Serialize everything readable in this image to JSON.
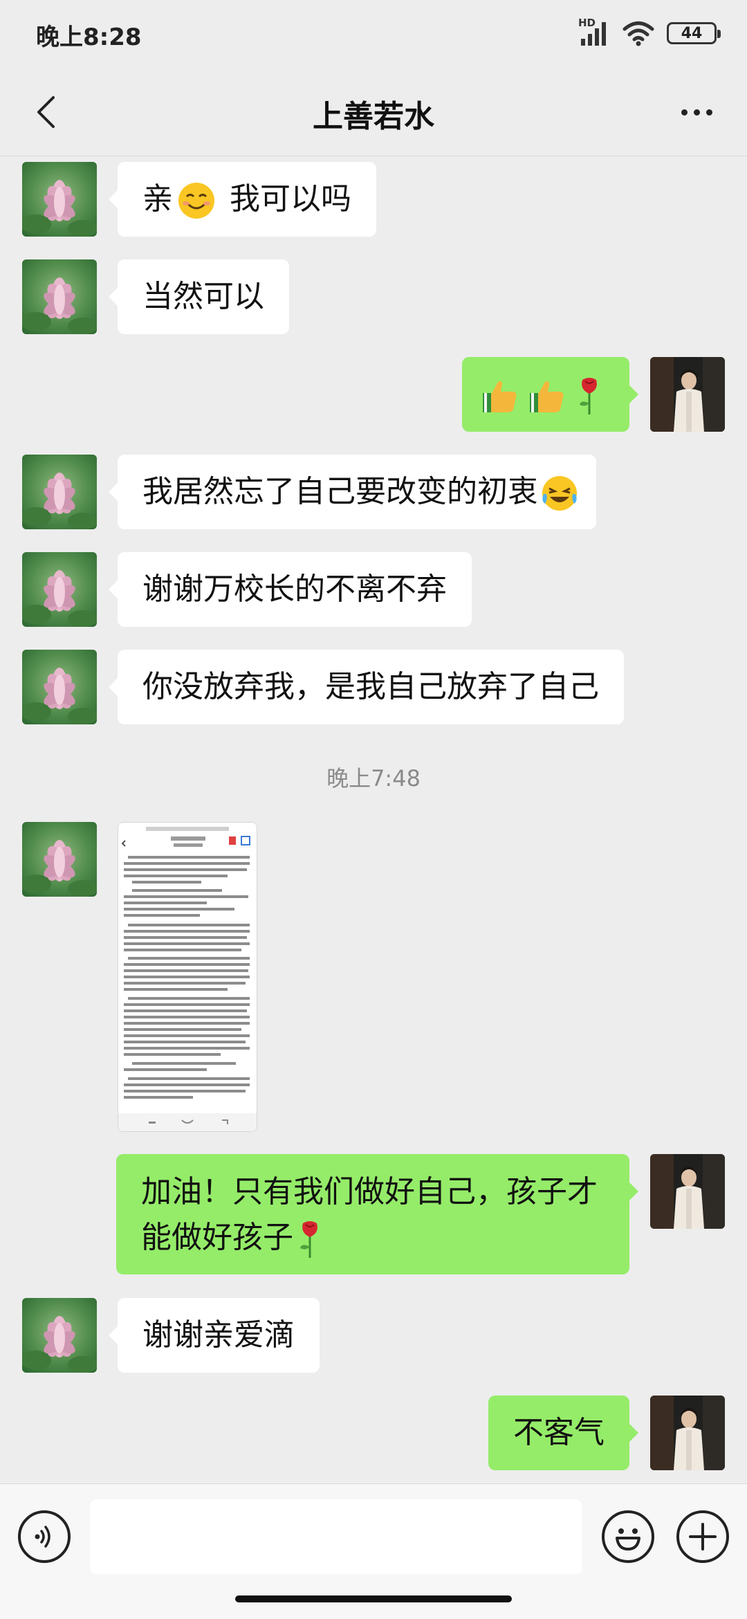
{
  "status_bar": {
    "time": "晚上8:28",
    "network": "HD",
    "battery": "44"
  },
  "header": {
    "title": "上善若水"
  },
  "messages": [
    {
      "side": "in",
      "text": "亲",
      "text_after": " 我可以吗",
      "emoji": "smiling-face"
    },
    {
      "side": "in",
      "text": "当然可以"
    },
    {
      "side": "out",
      "emoji": [
        "thumbs-up",
        "thumbs-up",
        "rose"
      ]
    },
    {
      "side": "in",
      "text": "我居然忘了自己要改变的初衷",
      "emoji": "laughing-tears-face"
    },
    {
      "side": "in",
      "text": "谢谢万校长的不离不弃"
    },
    {
      "side": "in",
      "text": "你没放弃我，是我自己放弃了自己"
    },
    {
      "side": "in",
      "type": "image"
    },
    {
      "side": "out",
      "line1": "加油！只有我们做好自己，孩子才",
      "line2": "能做好孩子",
      "emoji": "rose"
    },
    {
      "side": "in",
      "text": "谢谢亲爱滴"
    },
    {
      "side": "out",
      "text": "不客气"
    }
  ],
  "timestamp": "晚上7:48",
  "input": {
    "value": "",
    "placeholder": ""
  },
  "colors": {
    "background": "#ededed",
    "bubble_in": "#ffffff",
    "bubble_out": "#95ec69"
  }
}
